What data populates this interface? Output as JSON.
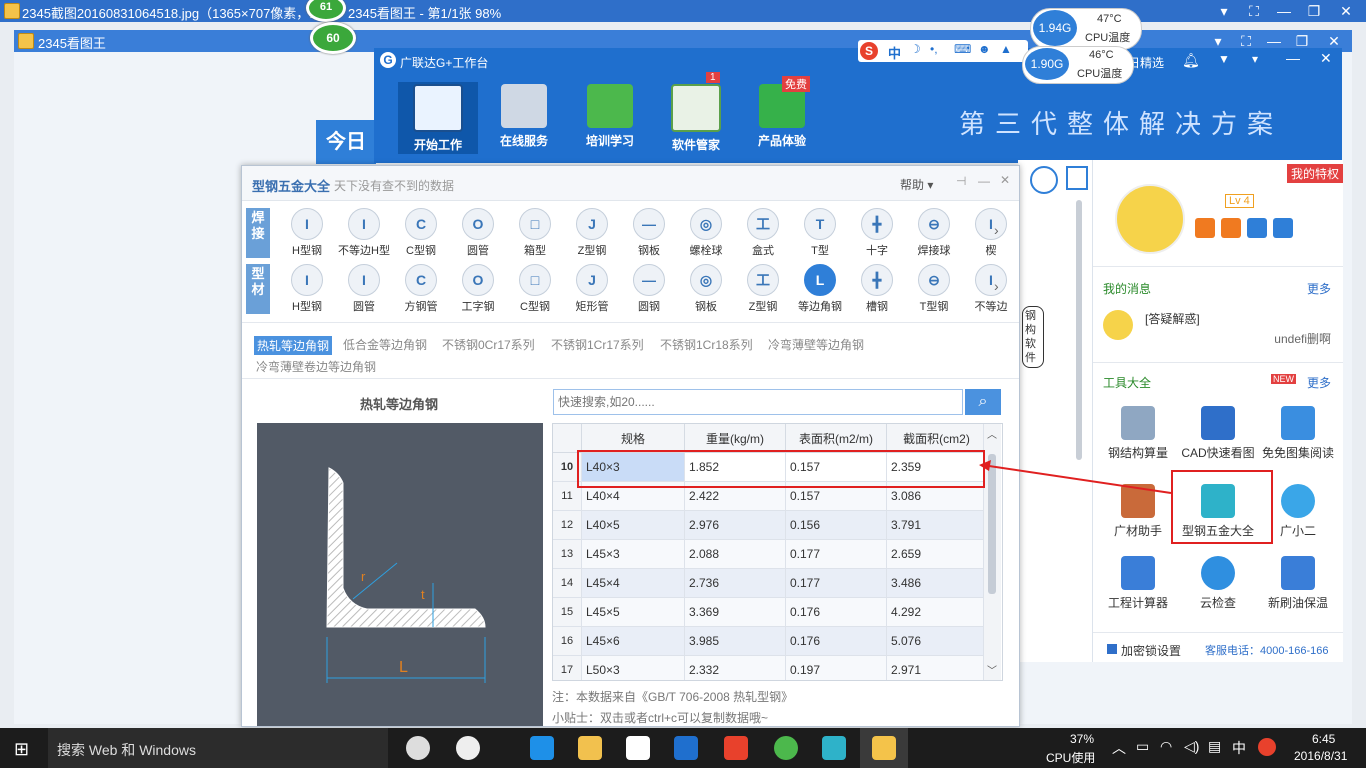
{
  "viewer": {
    "title": "2345截图20160831064518.jpg（1365×707像素，11",
    "title_tail": "2345看图王 - 第1/1张 98%",
    "inner_title": "2345看图王",
    "badge_top": "61",
    "badge_mid": "60",
    "today_label": "今日"
  },
  "cpu_widgets": [
    {
      "usage": "1.94G",
      "temp": "47°C",
      "label": "CPU温度"
    },
    {
      "usage": "1.90G",
      "temp": "46°C",
      "label": "CPU温度"
    }
  ],
  "glodon": {
    "title": "广联达G+工作台",
    "logo": "G",
    "today_pick": "日精选",
    "notification_count": "1",
    "free_badge": "免费",
    "slogan": "第三代整体解决方案",
    "tabs": [
      {
        "label": "开始工作",
        "active": true
      },
      {
        "label": "在线服务"
      },
      {
        "label": "培训学习"
      },
      {
        "label": "软件管家"
      },
      {
        "label": "产品体验"
      }
    ]
  },
  "ime_bar": {
    "label": "中"
  },
  "right_panel": {
    "privilege": "我的特权",
    "level": "Lv 4",
    "messages_title": "我的消息",
    "messages_more": "更多",
    "message_item": "[答疑解惑]",
    "message_user": "undefi删啊",
    "tools_title": "工具大全",
    "tools_new": "NEW",
    "tools_more": "更多",
    "tools": [
      {
        "label": "钢结构算量"
      },
      {
        "label": "CAD快速看图"
      },
      {
        "label": "免免图集阅读"
      },
      {
        "label": "广材助手"
      },
      {
        "label": "型钢五金大全"
      },
      {
        "label": "广小二"
      },
      {
        "label": "工程计算器"
      },
      {
        "label": "云检查"
      },
      {
        "label": "新刷油保温"
      }
    ],
    "lock_settings": "加密锁设置",
    "hotline": "客服电话：4000-166-166"
  },
  "mascot_text": "钢构软件",
  "dialog": {
    "title": "型钢五金大全",
    "subtitle": "天下没有查不到的数据",
    "help": "帮助",
    "row1_label": "焊接",
    "row2_label": "型材",
    "row1": [
      "H型钢",
      "不等边H型",
      "C型钢",
      "圆管",
      "箱型",
      "Z型钢",
      "钢板",
      "螺栓球",
      "盒式",
      "T型",
      "十字",
      "焊接球",
      "楔"
    ],
    "row2": [
      "H型钢",
      "圆管",
      "方钢管",
      "工字钢",
      "C型钢",
      "矩形管",
      "圆钢",
      "钢板",
      "Z型钢",
      "等边角钢",
      "槽钢",
      "T型钢",
      "不等边"
    ],
    "row2_selected": "等边角钢",
    "subtabs": [
      "热轧等边角钢",
      "低合金等边角钢",
      "不锈钢0Cr17系列",
      "不锈钢1Cr17系列",
      "不锈钢1Cr18系列",
      "冷弯薄壁等边角钢"
    ],
    "subtab_line2": "冷弯薄壁卷边等边角钢",
    "section_title": "热轧等边角钢",
    "dim_L": "L",
    "dim_r": "r",
    "dim_t": "t",
    "search_placeholder": "快速搜索,如20......",
    "columns": [
      "规格",
      "重量(kg/m)",
      "表面积(m2/m)",
      "截面积(cm2)"
    ],
    "rows": [
      {
        "n": "10",
        "spec": "L40×3",
        "w": "1.852",
        "s": "0.157",
        "a": "2.359"
      },
      {
        "n": "11",
        "spec": "L40×4",
        "w": "2.422",
        "s": "0.157",
        "a": "3.086"
      },
      {
        "n": "12",
        "spec": "L40×5",
        "w": "2.976",
        "s": "0.156",
        "a": "3.791"
      },
      {
        "n": "13",
        "spec": "L45×3",
        "w": "2.088",
        "s": "0.177",
        "a": "2.659"
      },
      {
        "n": "14",
        "spec": "L45×4",
        "w": "2.736",
        "s": "0.177",
        "a": "3.486"
      },
      {
        "n": "15",
        "spec": "L45×5",
        "w": "3.369",
        "s": "0.176",
        "a": "4.292"
      },
      {
        "n": "16",
        "spec": "L45×6",
        "w": "3.985",
        "s": "0.176",
        "a": "5.076"
      },
      {
        "n": "17",
        "spec": "L50×3",
        "w": "2.332",
        "s": "0.197",
        "a": "2.971"
      }
    ],
    "note": "注：本数据来自《GB/T  706-2008  热轧型钢》",
    "tip": "小贴士：双击或者ctrl+c可以复制数据哦~"
  },
  "taskbar": {
    "search": "搜索 Web 和 Windows",
    "cpu_percent": "37%",
    "cpu_label": "CPU使用",
    "ime": "中",
    "time": "6:45",
    "date": "2016/8/31"
  },
  "colors": {
    "accent": "#1f6fce",
    "highlight": "#e02020",
    "selected_row": "#c9dcf7"
  }
}
